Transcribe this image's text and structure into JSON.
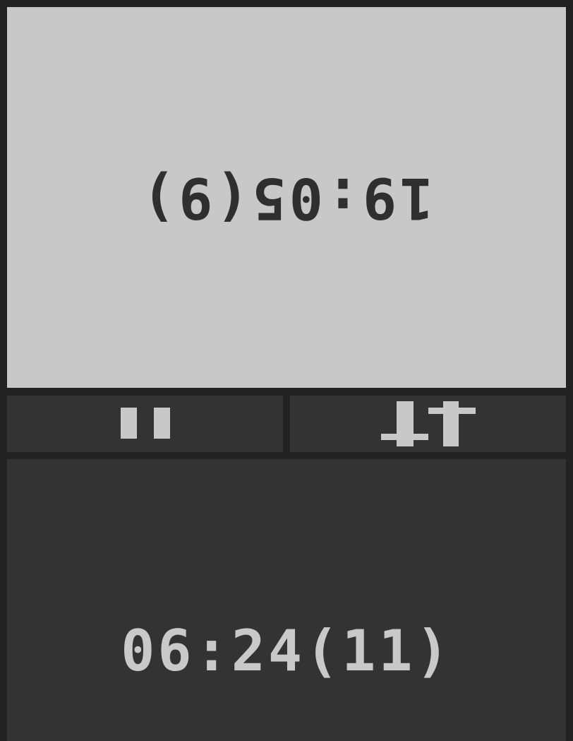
{
  "top_player": {
    "clock_display": "19:05(9)"
  },
  "bottom_player": {
    "clock_display": "06:24(11)"
  },
  "controls": {
    "pause_icon": "pause-icon",
    "swap_icon": "swap-arrows-icon"
  },
  "colors": {
    "background": "#222222",
    "top_panel": "#c8c8c8",
    "top_text": "#2f2f2f",
    "bottom_panel": "#333333",
    "bottom_text": "#c9c9c9",
    "control_panel": "#333333",
    "control_icon": "#c8c8c8"
  }
}
